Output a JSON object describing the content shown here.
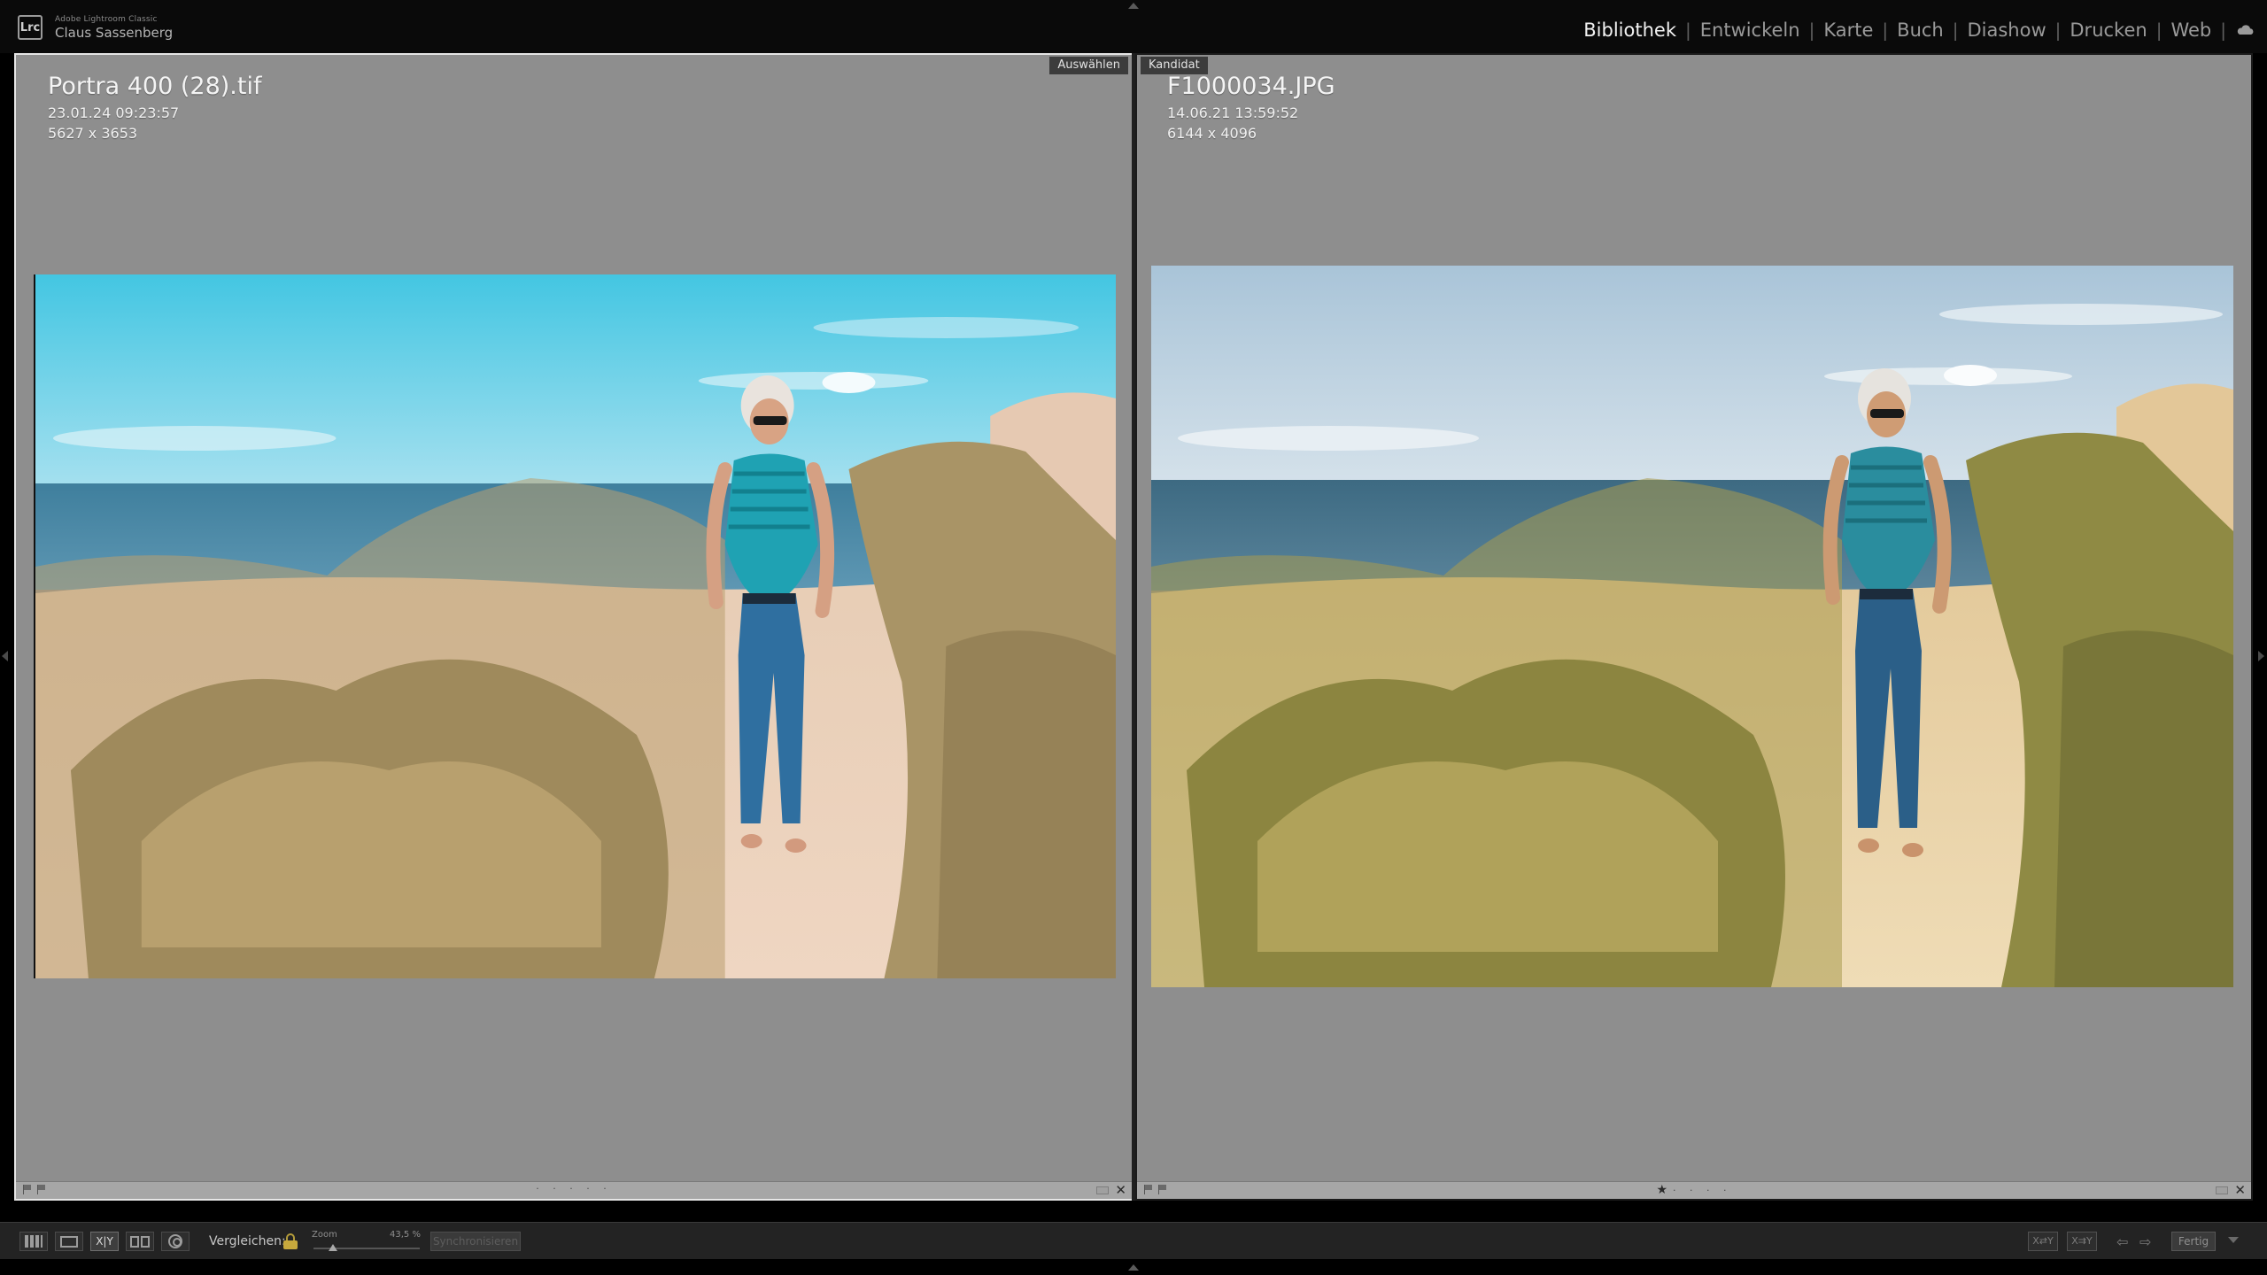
{
  "app": {
    "logo_text": "Lrc",
    "product_name": "Adobe Lightroom Classic",
    "user_name": "Claus Sassenberg"
  },
  "modules": [
    {
      "label": "Bibliothek",
      "active": true
    },
    {
      "label": "Entwickeln",
      "active": false
    },
    {
      "label": "Karte",
      "active": false
    },
    {
      "label": "Buch",
      "active": false
    },
    {
      "label": "Diashow",
      "active": false
    },
    {
      "label": "Drucken",
      "active": false
    },
    {
      "label": "Web",
      "active": false
    }
  ],
  "compare": {
    "select": {
      "tag": "Auswählen",
      "filename": "Portra 400 (28).tif",
      "datetime": "23.01.24 09:23:57",
      "dimensions": "5627 x 3653",
      "rating_stars": 0
    },
    "candidate": {
      "tag": "Kandidat",
      "filename": "F1000034.JPG",
      "datetime": "14.06.21 13:59:52",
      "dimensions": "6144 x 4096",
      "rating_stars": 1
    }
  },
  "toolbar": {
    "compare_label": "Vergleichen:",
    "zoom_label": "Zoom",
    "zoom_value": "43,5 %",
    "zoom_fraction": 0.18,
    "sync_label": "Synchronisieren",
    "xy_label": "X|Y",
    "swap_label": "X⇄Y",
    "make_select_label": "X⇉Y",
    "done_label": "Fertig"
  },
  "icons": {
    "grid_view": "grid-view-icon",
    "loupe_view": "loupe-view-icon",
    "compare_view": "compare-view-icon",
    "survey_view": "survey-view-icon",
    "people_view": "people-view-icon",
    "lock": "lock-icon",
    "cloud": "cloud-sync-icon",
    "flag": "flag-icon",
    "close": "close-icon",
    "prev": "arrow-left-icon",
    "next": "arrow-right-icon"
  },
  "colors": {
    "pane_background": "#8e8e8e",
    "active_module": "#f2f2f2",
    "inactive_module": "#9a9a9a",
    "lock_gold": "#c7a93d"
  }
}
